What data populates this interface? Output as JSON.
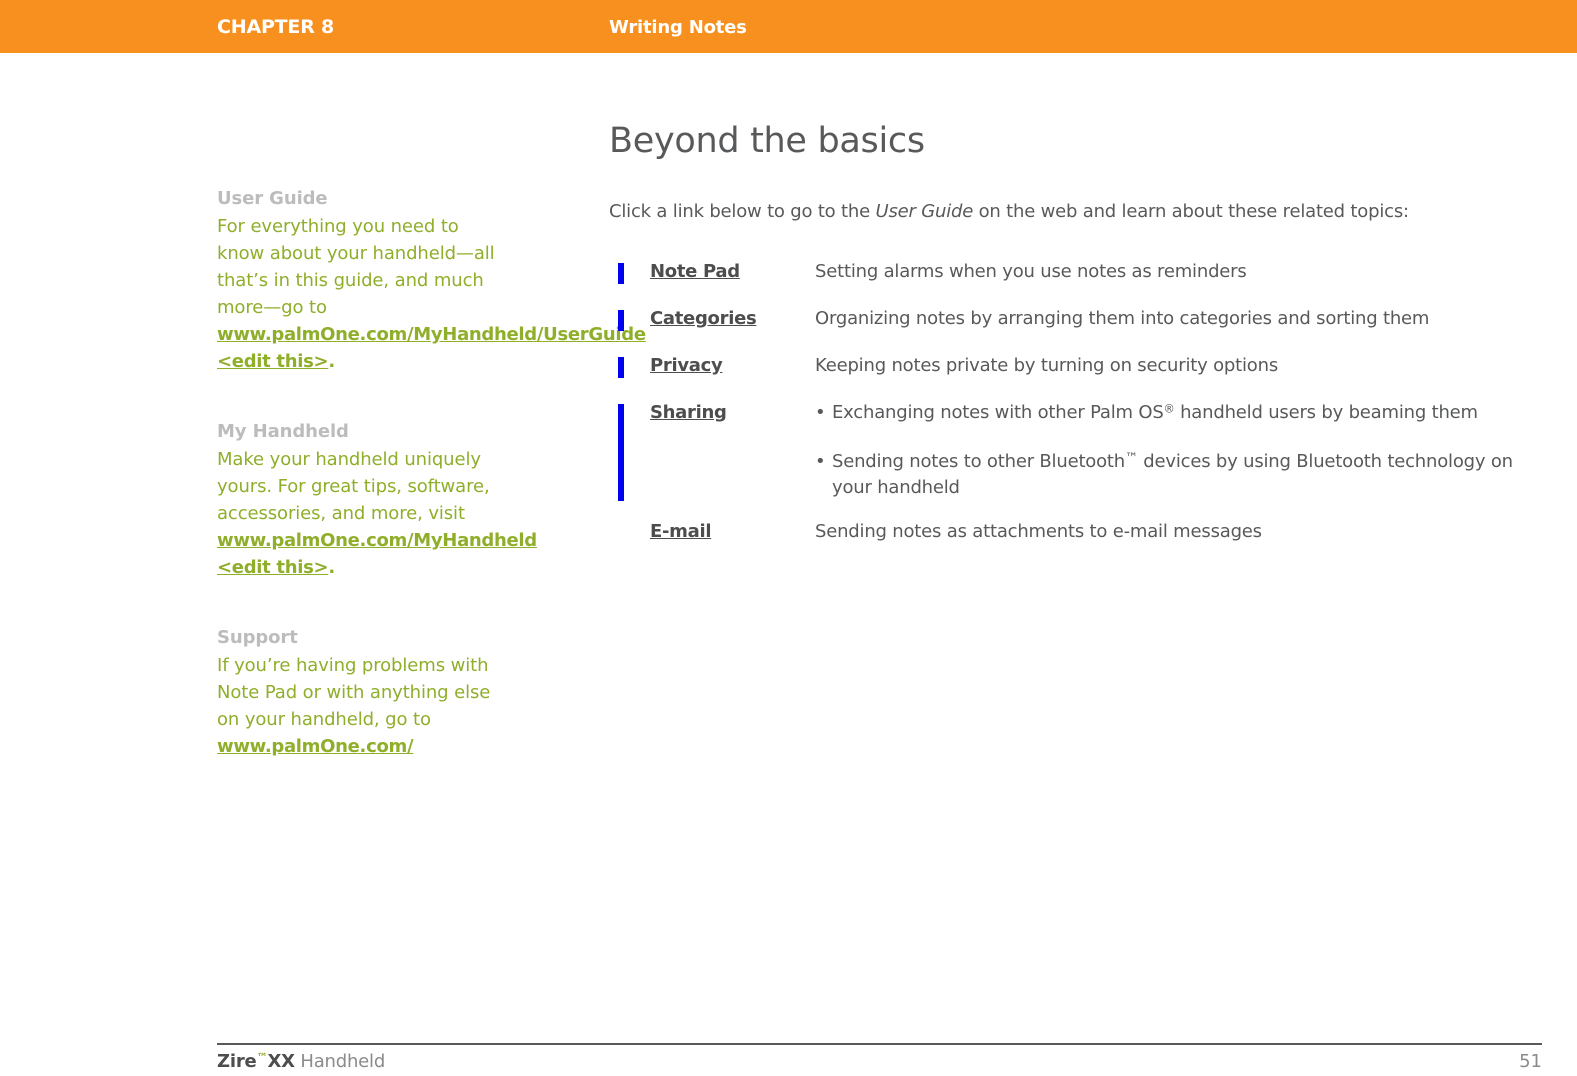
{
  "header": {
    "chapter": "CHAPTER 8",
    "title": "Writing Notes",
    "background_color": "#f7901e",
    "text_color": "#ffffff"
  },
  "sidebar": {
    "blocks": [
      {
        "heading": "User Guide",
        "body_before": "For everything you need to know about your handheld—all that’s in this guide, and much more—go to ",
        "link": "www.palmOne.com/MyHandheld/UserGuide <edit this>",
        "body_after": "."
      },
      {
        "heading": "My Handheld",
        "body_before": "Make your handheld uniquely yours. For great tips, software, accessories, and more, visit ",
        "link": "www.palmOne.com/MyHandheld <edit this>",
        "body_after": "."
      },
      {
        "heading": "Support",
        "body_before": "If you’re having problems with Note Pad or with anything else on your handheld, go to ",
        "link": "www.palmOne.com/",
        "body_after": ""
      }
    ],
    "heading_color": "#bcbcbc",
    "body_color": "#8fae2a"
  },
  "main": {
    "heading": "Beyond the basics",
    "intro_part1": "Click a link below to go to the ",
    "intro_italic": "User Guide",
    "intro_part2": " on the web and learn about these related topics:",
    "heading_color": "#58595b"
  },
  "topics": [
    {
      "label": "Note Pad",
      "description": "Setting alarms when you use notes as reminders",
      "has_bar": true,
      "bar_tall": false
    },
    {
      "label": "Categories",
      "description": "Organizing notes by arranging them into categories and sorting them",
      "has_bar": true,
      "bar_tall": false
    },
    {
      "label": "Privacy",
      "description": "Keeping notes private by turning on security options",
      "has_bar": true,
      "bar_tall": false
    },
    {
      "label": "Sharing",
      "has_bar": true,
      "bar_tall": true,
      "bullets": [
        {
          "text_before": "Exchanging notes with other Palm OS",
          "sup": "®",
          "text_after": " handheld users by beaming them"
        },
        {
          "text_before": "Sending notes to other Bluetooth",
          "tm": "™",
          "text_after": " devices by using Bluetooth technology on your handheld"
        }
      ],
      "bullet_glyph": "•"
    },
    {
      "label": "E-mail",
      "description": "Sending notes as attachments to e-mail messages",
      "has_bar": false,
      "bar_tall": false
    }
  ],
  "topic_bar_color": "#0000f0",
  "footer": {
    "brand": "Zire",
    "trademark": "™",
    "model": "XX",
    "product": " Handheld",
    "page_number": "51"
  }
}
